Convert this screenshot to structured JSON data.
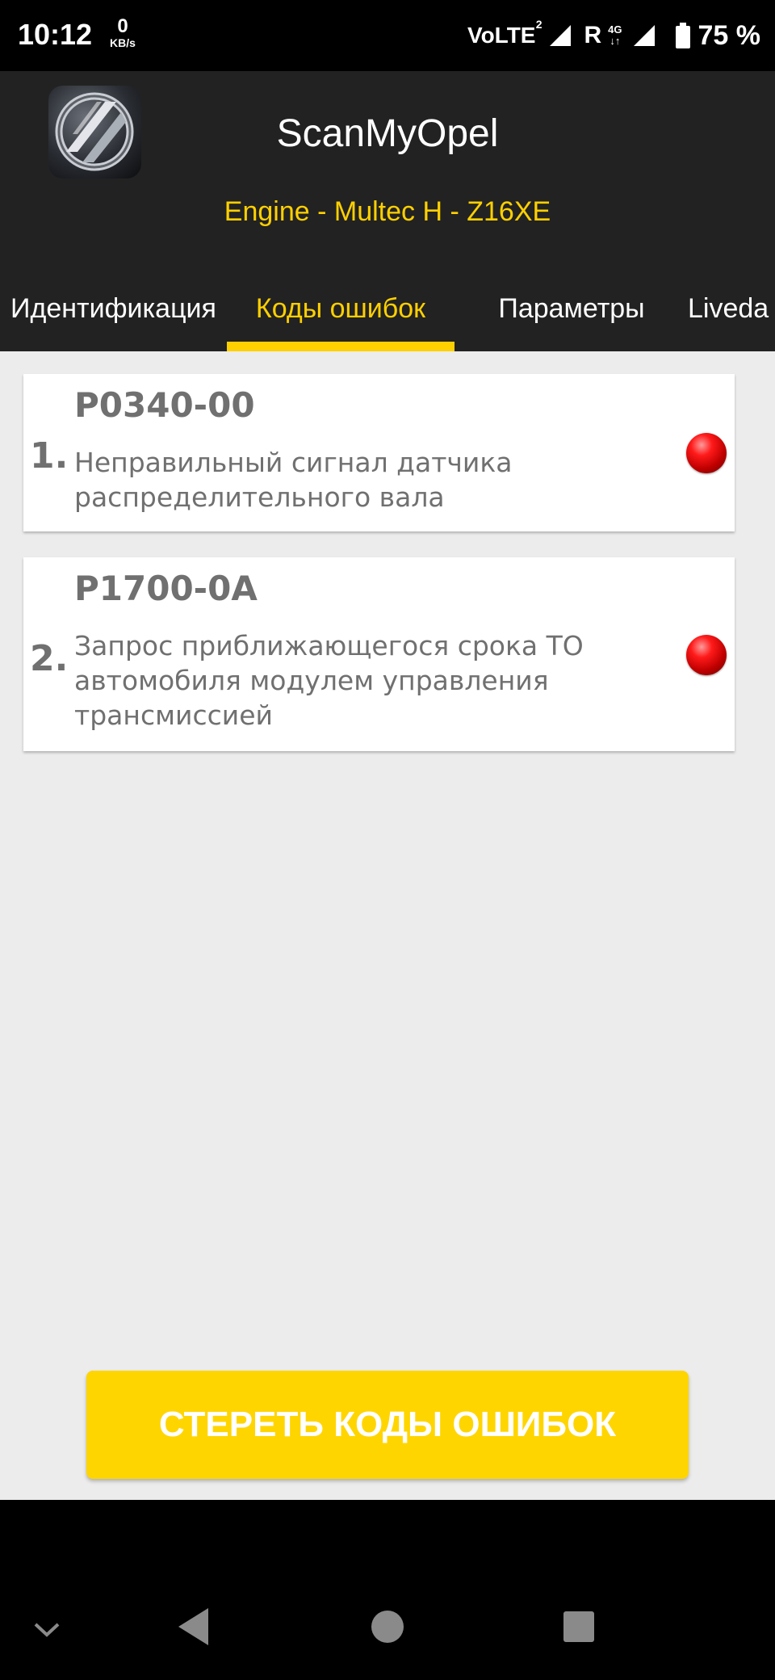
{
  "status_bar": {
    "time": "10:12",
    "speed_value": "0",
    "speed_unit": "KB/s",
    "volte": "VoLTE",
    "volte_sim": "2",
    "roaming": "R",
    "network": "4G",
    "battery": "75 %"
  },
  "app": {
    "title": "ScanMyOpel",
    "subtitle": "Engine - Multec H - Z16XE"
  },
  "tabs": [
    {
      "label": "Идентификация",
      "active": false
    },
    {
      "label": "Коды ошибок",
      "active": true
    },
    {
      "label": "Параметры",
      "active": false
    },
    {
      "label": "Liveda",
      "active": false
    }
  ],
  "errors": [
    {
      "number": "1.",
      "code": "P0340-00",
      "description": "Неправильный сигнал датчика распределительного вала",
      "status_color": "#e00000"
    },
    {
      "number": "2.",
      "code": "P1700-0A",
      "description": "Запрос приближающегося срока ТО автомобиля модулем управления трансмиссией",
      "status_color": "#e00000"
    }
  ],
  "clear_button": {
    "label": "СТЕРЕТЬ КОДЫ ОШИБОК"
  },
  "colors": {
    "accent": "#FFD000",
    "appbar": "#222222",
    "background": "#ececec",
    "text": "#707070"
  },
  "nav_icons": [
    "chevron-down-icon",
    "back-icon",
    "home-icon",
    "recents-icon"
  ]
}
